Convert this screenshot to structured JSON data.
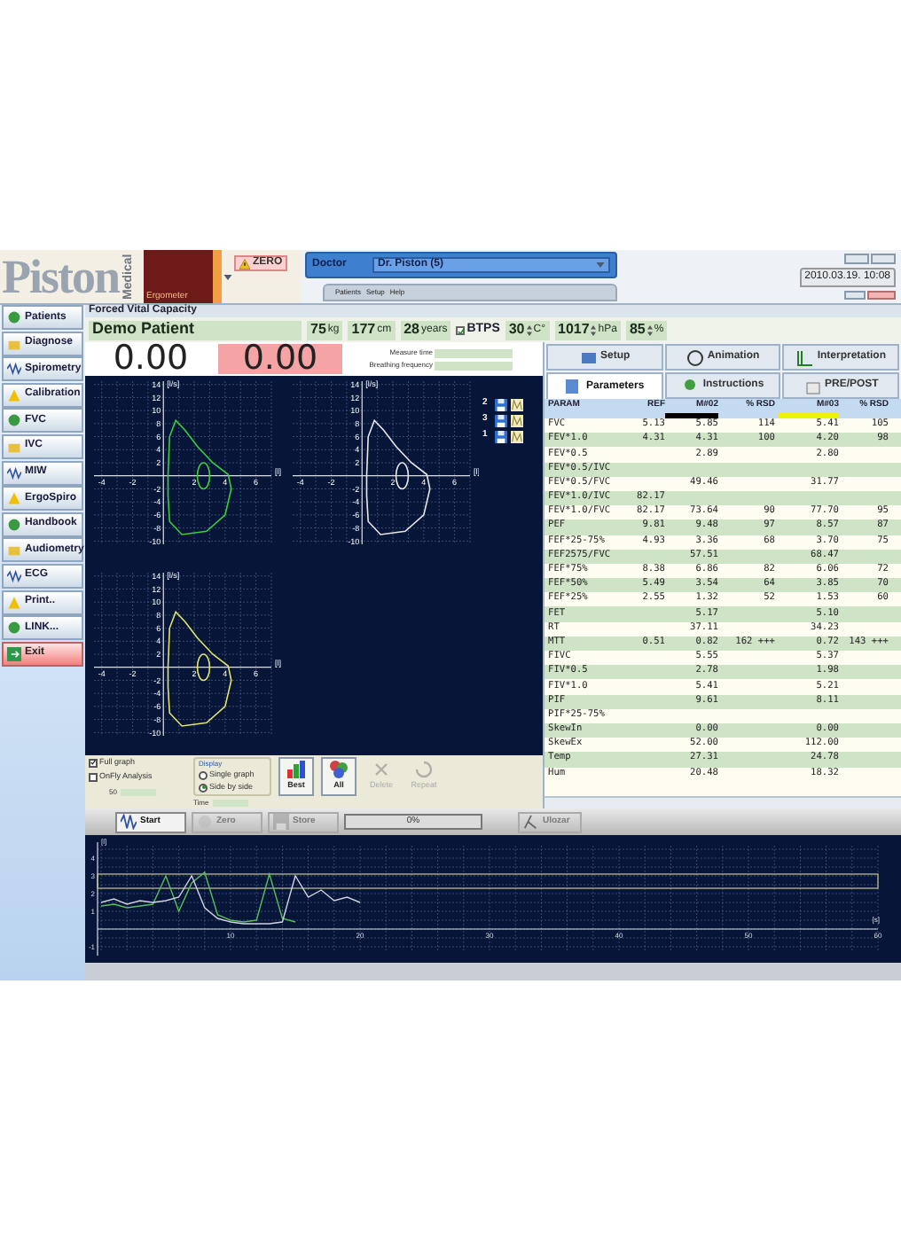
{
  "header": {
    "logo": "Piston",
    "logo_sub": "Medical",
    "device": "Ergometer",
    "zero_warning": "ZERO",
    "doctor_label": "Doctor",
    "doctor": "Dr. Piston (5)",
    "menu": [
      "Patients",
      "Setup",
      "Help"
    ],
    "datetime": "2010.03.19. 10:08"
  },
  "sidebar": [
    {
      "label": "Patients",
      "kind": "normal"
    },
    {
      "label": "Diagnose",
      "kind": "normal"
    },
    {
      "label": "Spirometry",
      "kind": "normal"
    },
    {
      "label": "Calibration",
      "kind": "normal"
    },
    {
      "label": "FVC",
      "kind": "normal"
    },
    {
      "label": "IVC",
      "kind": "normal"
    },
    {
      "label": "MIW",
      "kind": "normal"
    },
    {
      "label": "ErgoSpiro",
      "kind": "normal"
    },
    {
      "label": "Handbook",
      "kind": "normal"
    },
    {
      "label": "Audiometry",
      "kind": "normal"
    },
    {
      "label": "ECG",
      "kind": "normal"
    },
    {
      "label": "Print..",
      "kind": "normal"
    },
    {
      "label": "LINK...",
      "kind": "normal"
    },
    {
      "label": "Exit",
      "kind": "exit"
    }
  ],
  "screen_title": "Forced Vital Capacity",
  "patient": {
    "name": "Demo Patient",
    "fields": [
      {
        "value": "75",
        "unit": "kg"
      },
      {
        "value": "177",
        "unit": "cm"
      },
      {
        "value": "28",
        "unit": "years"
      }
    ],
    "btps": {
      "label": "BTPS",
      "checked": true
    },
    "conditions": [
      {
        "value": "30",
        "unit": "C°"
      },
      {
        "value": "1017",
        "unit": "hPa"
      },
      {
        "value": "85",
        "unit": "%"
      }
    ]
  },
  "readings": {
    "values": [
      {
        "value": "0.00",
        "kind": "plain"
      },
      {
        "value": "0.00",
        "kind": "alert"
      }
    ],
    "info": [
      "Measure time",
      "Breathing frequency"
    ]
  },
  "flow_volume_plots": [
    {
      "color": "#3ccf3c",
      "y_unit": "[l/s]",
      "x_unit": "[l]",
      "y_ticks": [
        "14",
        "12",
        "10",
        "8",
        "6",
        "4",
        "2",
        "-2",
        "-4",
        "-6",
        "-8",
        "-10"
      ],
      "x_ticks": [
        "-4",
        "-2",
        "2",
        "4",
        "6"
      ]
    },
    {
      "color": "#e8e8e8",
      "y_unit": "[l/s]",
      "x_unit": "[l]",
      "y_ticks": [
        "14",
        "12",
        "10",
        "8",
        "6",
        "4",
        "2",
        "-2",
        "-4",
        "-6",
        "-8",
        "-10"
      ],
      "x_ticks": [
        "-4",
        "-2",
        "2",
        "4",
        "6"
      ]
    },
    {
      "color": "#e4e46a",
      "y_unit": "[l/s]",
      "x_unit": "[l]",
      "y_ticks": [
        "14",
        "12",
        "10",
        "8",
        "6",
        "4",
        "2",
        "-2",
        "-4",
        "-6",
        "-8",
        "-10"
      ],
      "x_ticks": [
        "-4",
        "-2",
        "2",
        "4",
        "6"
      ]
    }
  ],
  "measurement_slots": [
    {
      "number": "2"
    },
    {
      "number": "3"
    },
    {
      "number": "1"
    }
  ],
  "tab_rows": [
    [
      {
        "label": "Setup",
        "selected": false
      },
      {
        "label": "Animation",
        "selected": false
      },
      {
        "label": "Interpretation",
        "selected": false
      }
    ],
    [
      {
        "label": "Parameters",
        "selected": true
      },
      {
        "label": "Instructions",
        "selected": false
      },
      {
        "label": "PRE/POST",
        "selected": false
      }
    ]
  ],
  "parameters_table": {
    "columns": [
      {
        "label": "PARAM"
      },
      {
        "label": "REF"
      },
      {
        "label": "M#02",
        "color": "#000000"
      },
      {
        "label": "% RSD"
      },
      {
        "label": "M#03",
        "color": "#f0f000"
      },
      {
        "label": "% RSD"
      }
    ],
    "rows": [
      {
        "param": "FVC",
        "ref": "5.13",
        "m1": "5.85",
        "p1": "114",
        "m2": "5.41",
        "p2": "105"
      },
      {
        "param": "FEV*1.0",
        "ref": "4.31",
        "m1": "4.31",
        "p1": "100",
        "m2": "4.20",
        "p2": "98"
      },
      {
        "param": "FEV*0.5",
        "m1": "2.89",
        "m2": "2.80"
      },
      {
        "param": "FEV*0.5/IVC"
      },
      {
        "param": "FEV*0.5/FVC",
        "m1": "49.46",
        "m2": "31.77"
      },
      {
        "param": "FEV*1.0/IVC",
        "ref": "82.17"
      },
      {
        "param": "FEV*1.0/FVC",
        "ref": "82.17",
        "m1": "73.64",
        "p1": "90",
        "m2": "77.70",
        "p2": "95"
      },
      {
        "param": "PEF",
        "ref": "9.81",
        "m1": "9.48",
        "p1": "97",
        "m2": "8.57",
        "p2": "87"
      },
      {
        "param": "FEF*25-75%",
        "ref": "4.93",
        "m1": "3.36",
        "p1": "68",
        "m2": "3.70",
        "p2": "75"
      },
      {
        "param": "FEF2575/FVC",
        "m1": "57.51",
        "m2": "68.47"
      },
      {
        "param": "FEF*75%",
        "ref": "8.38",
        "m1": "6.86",
        "p1": "82",
        "m2": "6.06",
        "p2": "72"
      },
      {
        "param": "FEF*50%",
        "ref": "5.49",
        "m1": "3.54",
        "p1": "64",
        "m2": "3.85",
        "p2": "70"
      },
      {
        "param": "FEF*25%",
        "ref": "2.55",
        "m1": "1.32",
        "p1": "52",
        "m2": "1.53",
        "p2": "60"
      },
      {
        "param": "FET",
        "m1": "5.17",
        "m2": "5.10"
      },
      {
        "param": "RT",
        "m1": "37.11",
        "m2": "34.23"
      },
      {
        "param": "MTT",
        "ref": "0.51",
        "m1": "0.82",
        "p1": "162 +++",
        "m2": "0.72",
        "p2": "143 +++"
      },
      {
        "param": "FIVC",
        "m1": "5.55",
        "m2": "5.37"
      },
      {
        "param": "FIV*0.5",
        "m1": "2.78",
        "m2": "1.98"
      },
      {
        "param": "FIV*1.0",
        "m1": "5.41",
        "m2": "5.21"
      },
      {
        "param": "PIF",
        "m1": "9.61",
        "m2": "8.11"
      },
      {
        "param": "PIF*25-75%"
      },
      {
        "param": "SkewIn",
        "m1": "0.00",
        "m2": "0.00"
      },
      {
        "param": "SkewEx",
        "m1": "52.00",
        "m2": "112.00"
      },
      {
        "param": "Temp",
        "m1": "27.31",
        "m2": "24.78"
      },
      {
        "param": "Hum",
        "m1": "20.48",
        "m2": "18.32"
      }
    ]
  },
  "options": {
    "checkboxes": [
      {
        "label": "Full graph",
        "checked": true
      },
      {
        "label": "OnFly Analysis",
        "checked": false
      }
    ],
    "display": {
      "label": "Display",
      "options": [
        {
          "label": "Single graph",
          "selected": false
        },
        {
          "label": "Side by side",
          "selected": true
        }
      ]
    },
    "indicators": [
      "50",
      "Time"
    ]
  },
  "curve_buttons": [
    {
      "label": "Best",
      "disabled": false
    },
    {
      "label": "All",
      "disabled": false
    },
    {
      "label": "Delete",
      "disabled": true
    },
    {
      "label": "Repeat",
      "disabled": true
    }
  ],
  "toolbar": {
    "buttons": [
      {
        "label": "Start",
        "disabled": false
      },
      {
        "label": "Zero",
        "disabled": true
      },
      {
        "label": "Store",
        "disabled": true
      }
    ],
    "progress": {
      "level": 0,
      "reading": "0%"
    },
    "end_button": {
      "label": "Ulozar",
      "disabled": true
    }
  },
  "volume_time_graph": {
    "chart_data": {
      "type": "line",
      "xlabel": "[s]",
      "ylabel": "[l]",
      "x": [
        0,
        1,
        2,
        3,
        4,
        5,
        6,
        7,
        8,
        9,
        10,
        11,
        12,
        13,
        14,
        15,
        16,
        17,
        18,
        19,
        20
      ],
      "series": [
        {
          "color": "#58c058",
          "values": [
            1.3,
            1.4,
            1.2,
            1.3,
            1.4,
            3.0,
            1.0,
            2.6,
            3.2,
            0.8,
            0.5,
            0.4,
            0.5,
            3.1,
            0.6,
            0.4,
            null,
            null,
            null,
            null,
            null
          ]
        },
        {
          "color": "#d0d4e0",
          "values": [
            1.5,
            1.7,
            1.4,
            1.6,
            1.5,
            1.6,
            1.8,
            3.0,
            1.2,
            0.6,
            0.4,
            0.3,
            0.3,
            0.3,
            0.4,
            3.0,
            1.8,
            2.2,
            1.6,
            1.8,
            1.5
          ]
        }
      ],
      "xlim": [
        0,
        60
      ],
      "ylim": [
        -1,
        4.5
      ],
      "grid": true,
      "xticks": [
        10,
        20,
        30,
        40,
        50,
        60
      ],
      "yticks": [
        4,
        3,
        2,
        1,
        -1
      ]
    }
  }
}
